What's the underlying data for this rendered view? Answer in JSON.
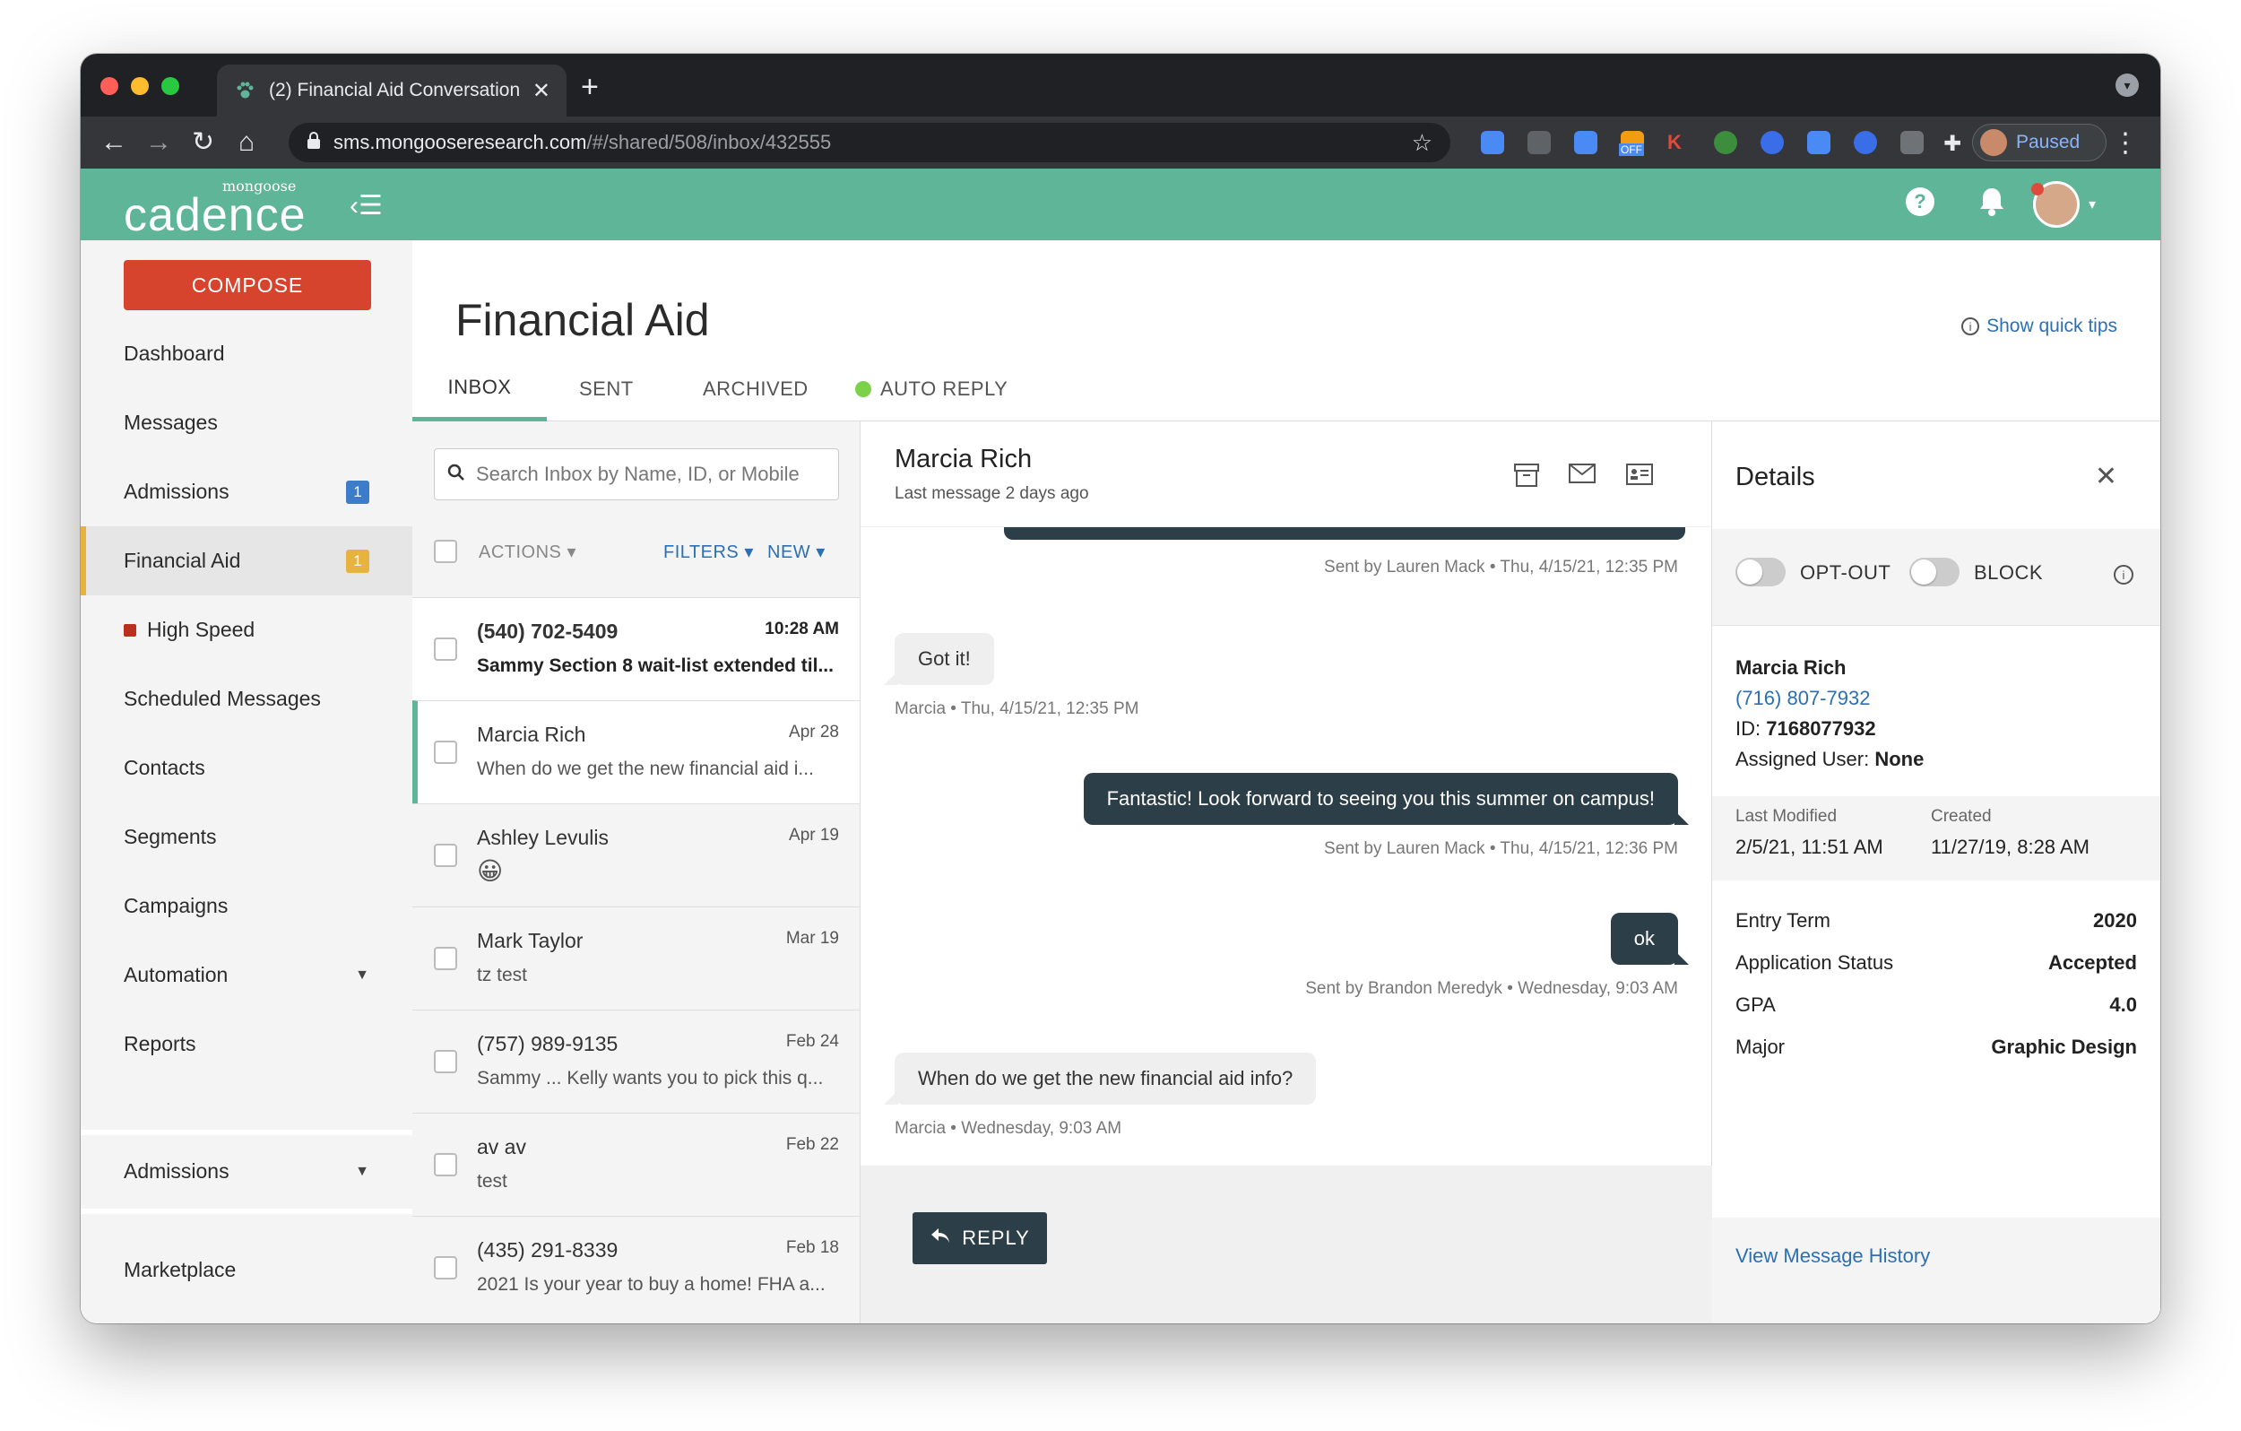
{
  "browser": {
    "tab_title": "(2) Financial Aid Conversation",
    "url_host": "sms.mongooseresearch.com",
    "url_path": "/#/shared/508/inbox/432555",
    "profile_label": "Paused",
    "extension_off_label": "OFF"
  },
  "header": {
    "logo_small": "mongoose",
    "logo_big": "cadence"
  },
  "sidebar": {
    "compose_label": "COMPOSE",
    "items": [
      {
        "label": "Dashboard"
      },
      {
        "label": "Messages"
      },
      {
        "label": "Admissions",
        "badge": "1"
      },
      {
        "label": "Financial Aid",
        "badge": "1"
      },
      {
        "label": "High Speed"
      },
      {
        "label": "Scheduled Messages"
      },
      {
        "label": "Contacts"
      },
      {
        "label": "Segments"
      },
      {
        "label": "Campaigns"
      },
      {
        "label": "Automation"
      },
      {
        "label": "Reports"
      }
    ],
    "bottom_admissions": "Admissions",
    "marketplace": "Marketplace"
  },
  "main": {
    "title": "Financial Aid",
    "quick_tips": "Show quick tips",
    "tabs": [
      {
        "label": "INBOX"
      },
      {
        "label": "SENT"
      },
      {
        "label": "ARCHIVED"
      },
      {
        "label": "AUTO REPLY"
      }
    ]
  },
  "list": {
    "search_placeholder": "Search Inbox by Name, ID, or Mobile",
    "actions_label": "ACTIONS",
    "filters_label": "FILTERS",
    "new_label": "NEW",
    "conversations": [
      {
        "name": "(540) 702-5409",
        "time": "10:28 AM",
        "snippet": "Sammy Section 8 wait-list extended til..."
      },
      {
        "name": "Marcia Rich",
        "time": "Apr 28",
        "snippet": "When do we get the new financial aid i..."
      },
      {
        "name": "Ashley Levulis",
        "time": "Apr 19",
        "snippet": "😀"
      },
      {
        "name": "Mark Taylor",
        "time": "Mar 19",
        "snippet": "tz test"
      },
      {
        "name": "(757) 989-9135",
        "time": "Feb 24",
        "snippet": "Sammy ... Kelly wants you to pick this q..."
      },
      {
        "name": "av av",
        "time": "Feb 22",
        "snippet": "test"
      },
      {
        "name": "(435) 291-8339",
        "time": "Feb 18",
        "snippet": "2021 Is your year to buy a home! FHA a..."
      }
    ]
  },
  "thread": {
    "contact_name": "Marcia Rich",
    "last_message": "Last message 2 days ago",
    "messages": [
      {
        "meta": "Sent by Lauren Mack • Thu, 4/15/21, 12:35 PM"
      },
      {
        "text": "Got it!",
        "meta": "Marcia • Thu, 4/15/21, 12:35 PM"
      },
      {
        "text": "Fantastic! Look forward to seeing you this summer on campus!",
        "meta": "Sent by Lauren Mack • Thu, 4/15/21, 12:36 PM"
      },
      {
        "text": "ok",
        "meta": "Sent by Brandon Meredyk • Wednesday, 9:03 AM"
      },
      {
        "text": "When do we get the new financial aid info?",
        "meta": "Marcia • Wednesday, 9:03 AM"
      }
    ],
    "reply_label": "REPLY"
  },
  "details": {
    "title": "Details",
    "opt_out_label": "OPT-OUT",
    "block_label": "BLOCK",
    "name": "Marcia Rich",
    "phone": "(716) 807-7932",
    "id_label": "ID:",
    "id_value": "7168077932",
    "assigned_label": "Assigned User:",
    "assigned_value": "None",
    "last_modified_label": "Last Modified",
    "last_modified_value": "2/5/21, 11:51 AM",
    "created_label": "Created",
    "created_value": "11/27/19, 8:28 AM",
    "attributes": [
      {
        "label": "Entry Term",
        "value": "2020"
      },
      {
        "label": "Application Status",
        "value": "Accepted"
      },
      {
        "label": "GPA",
        "value": "4.0"
      },
      {
        "label": "Major",
        "value": "Graphic Design"
      }
    ],
    "history_link": "View Message History"
  },
  "colors": {
    "brand_green": "#5fb597",
    "compose_red": "#d6442d",
    "dark_bubble": "#2c3e47",
    "link_blue": "#2c6fb2",
    "badge_gold": "#e6b33e",
    "badge_blue": "#3d7cc9"
  }
}
